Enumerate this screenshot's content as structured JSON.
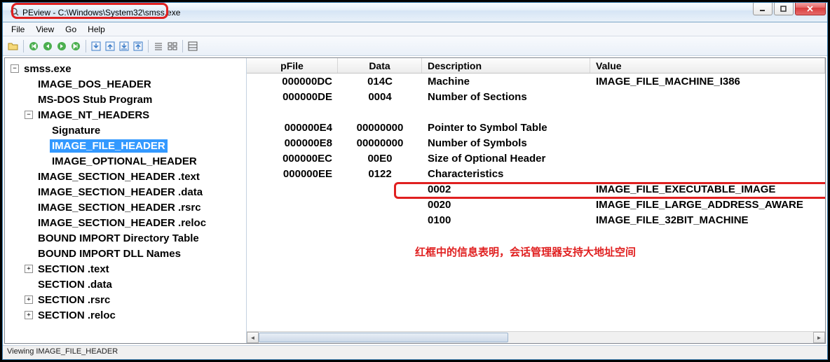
{
  "title": "PEview - C:\\Windows\\System32\\smss.exe",
  "menu": {
    "file": "File",
    "view": "View",
    "go": "Go",
    "help": "Help"
  },
  "toolbar_icons": [
    "open-file",
    "first",
    "prev",
    "next",
    "last",
    "sep",
    "import",
    "export",
    "import2",
    "export2",
    "sep",
    "list-view",
    "detail-view",
    "sep",
    "hex-view"
  ],
  "tree": [
    {
      "lvl": 0,
      "exp": "-",
      "label": "smss.exe"
    },
    {
      "lvl": 1,
      "exp": "",
      "label": "IMAGE_DOS_HEADER"
    },
    {
      "lvl": 1,
      "exp": "",
      "label": "MS-DOS Stub Program"
    },
    {
      "lvl": 1,
      "exp": "-",
      "label": "IMAGE_NT_HEADERS"
    },
    {
      "lvl": 2,
      "exp": "",
      "label": "Signature"
    },
    {
      "lvl": 2,
      "exp": "",
      "label": "IMAGE_FILE_HEADER",
      "sel": true
    },
    {
      "lvl": 2,
      "exp": "",
      "label": "IMAGE_OPTIONAL_HEADER"
    },
    {
      "lvl": 1,
      "exp": "",
      "label": "IMAGE_SECTION_HEADER .text"
    },
    {
      "lvl": 1,
      "exp": "",
      "label": "IMAGE_SECTION_HEADER .data"
    },
    {
      "lvl": 1,
      "exp": "",
      "label": "IMAGE_SECTION_HEADER .rsrc"
    },
    {
      "lvl": 1,
      "exp": "",
      "label": "IMAGE_SECTION_HEADER .reloc"
    },
    {
      "lvl": 1,
      "exp": "",
      "label": "BOUND IMPORT Directory Table"
    },
    {
      "lvl": 1,
      "exp": "",
      "label": "BOUND IMPORT DLL Names"
    },
    {
      "lvl": 1,
      "exp": "+",
      "label": "SECTION .text"
    },
    {
      "lvl": 1,
      "exp": "",
      "label": "SECTION .data"
    },
    {
      "lvl": 1,
      "exp": "+",
      "label": "SECTION .rsrc"
    },
    {
      "lvl": 1,
      "exp": "+",
      "label": "SECTION .reloc"
    }
  ],
  "columns": {
    "pfile": "pFile",
    "data": "Data",
    "desc": "Description",
    "value": "Value"
  },
  "rows": [
    {
      "pfile": "000000DC",
      "data": "014C",
      "desc": "Machine",
      "value": "IMAGE_FILE_MACHINE_I386"
    },
    {
      "pfile": "000000DE",
      "data": "0004",
      "desc": "Number of Sections",
      "value": ""
    },
    {
      "pfile": "",
      "data": "",
      "desc": "",
      "value": ""
    },
    {
      "pfile": "000000E4",
      "data": "00000000",
      "desc": "Pointer to Symbol Table",
      "value": ""
    },
    {
      "pfile": "000000E8",
      "data": "00000000",
      "desc": "Number of Symbols",
      "value": ""
    },
    {
      "pfile": "000000EC",
      "data": "00E0",
      "desc": "Size of Optional Header",
      "value": ""
    },
    {
      "pfile": "000000EE",
      "data": "0122",
      "desc": "Characteristics",
      "value": ""
    },
    {
      "pfile": "",
      "data": "",
      "desc": "0002",
      "value": "IMAGE_FILE_EXECUTABLE_IMAGE"
    },
    {
      "pfile": "",
      "data": "",
      "desc": "0020",
      "value": "IMAGE_FILE_LARGE_ADDRESS_AWARE"
    },
    {
      "pfile": "",
      "data": "",
      "desc": "0100",
      "value": "IMAGE_FILE_32BIT_MACHINE"
    }
  ],
  "annotation_text": "红框中的信息表明，会话管理器支持大地址空间",
  "status": "Viewing IMAGE_FILE_HEADER"
}
